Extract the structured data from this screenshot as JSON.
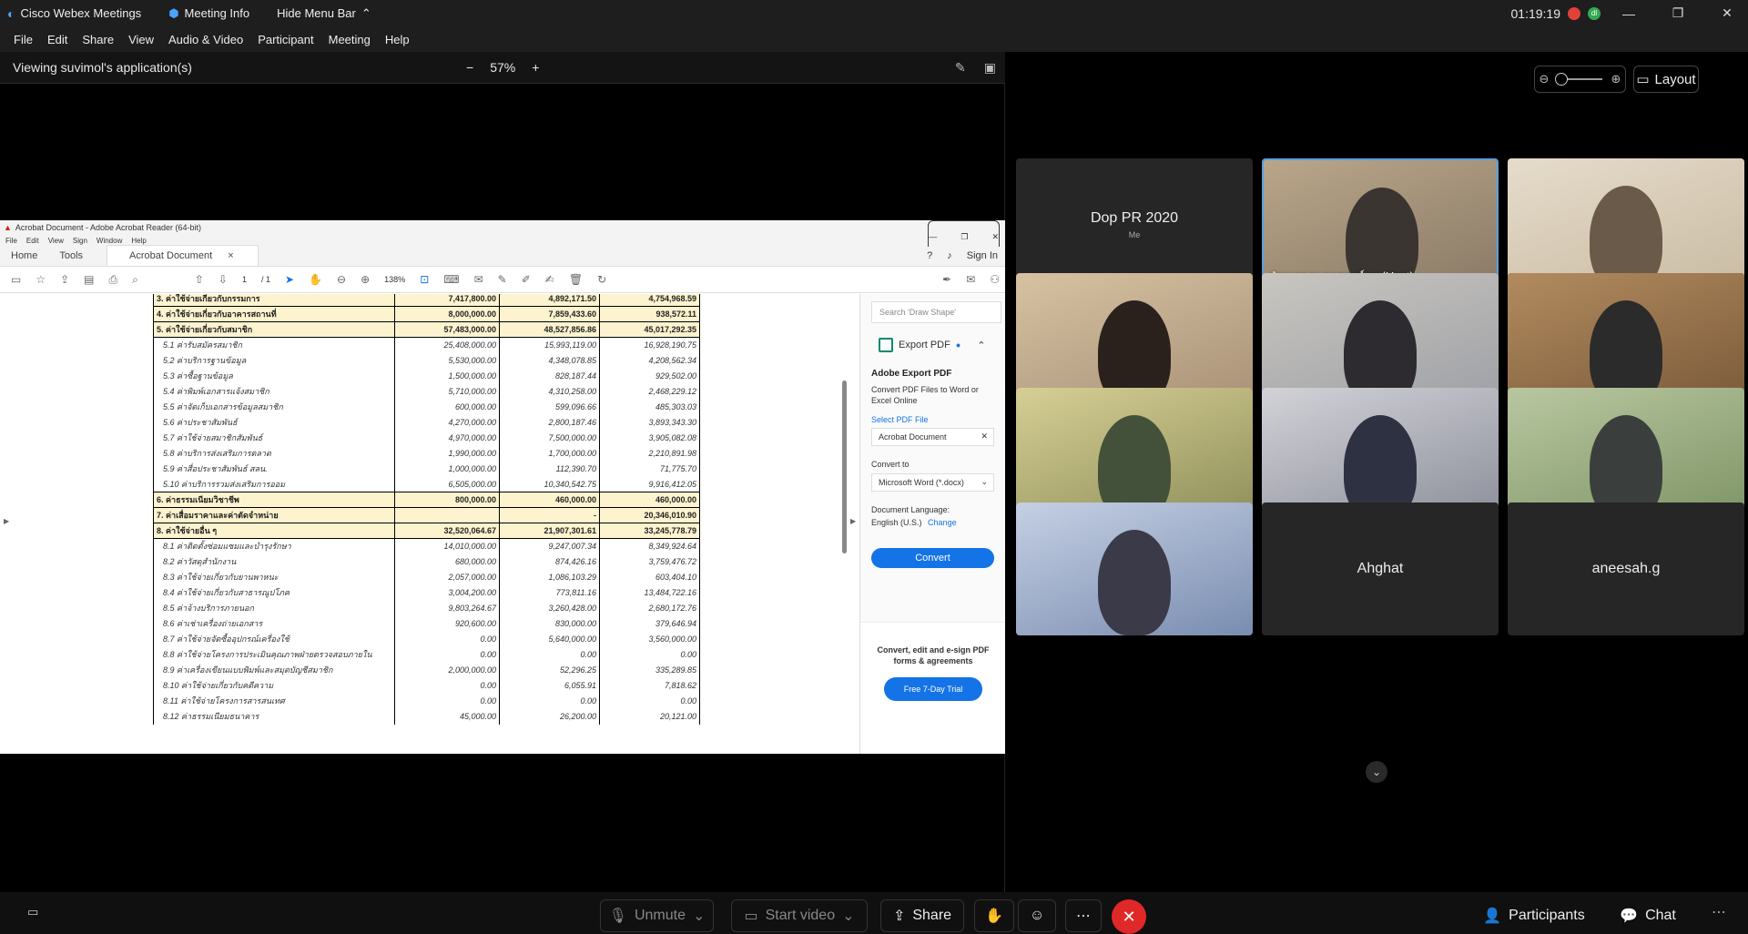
{
  "titlebar": {
    "app": "Cisco Webex Meetings",
    "meeting_info": "Meeting Info",
    "hide_menu": "Hide Menu Bar",
    "time": "01:19:19",
    "avatar_initial": "dl"
  },
  "menu": [
    "File",
    "Edit",
    "Share",
    "View",
    "Audio & Video",
    "Participant",
    "Meeting",
    "Help"
  ],
  "viewbar": {
    "title": "Viewing suvimol's application(s)",
    "zoom": "57%"
  },
  "acrobat": {
    "window_title": "Acrobat Document - Adobe Acrobat Reader (64-bit)",
    "menu": [
      "File",
      "Edit",
      "View",
      "Sign",
      "Window",
      "Help"
    ],
    "tabs": {
      "home": "Home",
      "tools": "Tools",
      "doc": "Acrobat Document"
    },
    "sign_in": "Sign In",
    "page": "1",
    "page_total": "/ 1",
    "zoom": "138%",
    "table": [
      {
        "bold": true,
        "label": "3. ค่าใช้จ่ายเกี่ยวกับกรรมการ",
        "a": "7,417,800.00",
        "b": "4,892,171.50",
        "c": "4,754,968.59"
      },
      {
        "bold": true,
        "label": "4. ค่าใช้จ่ายเกี่ยวกับอาคารสถานที่",
        "a": "8,000,000.00",
        "b": "7,859,433.60",
        "c": "938,572.11"
      },
      {
        "bold": true,
        "label": "5. ค่าใช้จ่ายเกี่ยวกับสมาชิก",
        "a": "57,483,000.00",
        "b": "48,527,856.86",
        "c": "45,017,292.35"
      },
      {
        "bold": false,
        "label": "5.1 ค่ารับสมัครสมาชิก",
        "a": "25,408,000.00",
        "b": "15,993,119.00",
        "c": "16,928,190.75"
      },
      {
        "bold": false,
        "label": "5.2 ค่าบริการฐานข้อมูล",
        "a": "5,530,000.00",
        "b": "4,348,078.85",
        "c": "4,208,562.34"
      },
      {
        "bold": false,
        "label": "5.3 ค่าซื้อฐานข้อมูล",
        "a": "1,500,000.00",
        "b": "828,187.44",
        "c": "929,502.00"
      },
      {
        "bold": false,
        "label": "5.4 ค่าพิมพ์เอกสารแจ้งสมาชิก",
        "a": "5,710,000.00",
        "b": "4,310,258.00",
        "c": "2,468,229.12"
      },
      {
        "bold": false,
        "label": "5.5 ค่าจัดเก็บเอกสารข้อมูลสมาชิก",
        "a": "600,000.00",
        "b": "599,096.66",
        "c": "485,303.03"
      },
      {
        "bold": false,
        "label": "5.6 ค่าประชาสัมพันธ์",
        "a": "4,270,000.00",
        "b": "2,800,187.46",
        "c": "3,893,343.30"
      },
      {
        "bold": false,
        "label": "5.7 ค่าใช้จ่ายสมาชิกสัมพันธ์",
        "a": "4,970,000.00",
        "b": "7,500,000.00",
        "c": "3,905,082.08"
      },
      {
        "bold": false,
        "label": "5.8 ค่าบริการส่งเสริมการตลาด",
        "a": "1,990,000.00",
        "b": "1,700,000.00",
        "c": "2,210,891.98"
      },
      {
        "bold": false,
        "label": "5.9 ค่าสื่อประชาสัมพันธ์ สลน.",
        "a": "1,000,000.00",
        "b": "112,390.70",
        "c": "71,775.70"
      },
      {
        "bold": false,
        "label": "5.10 ค่าบริการรวมส่งเสริมการออม",
        "a": "6,505,000.00",
        "b": "10,340,542.75",
        "c": "9,916,412.05"
      },
      {
        "bold": true,
        "label": "6. ค่าธรรมเนียมวิชาชีพ",
        "a": "800,000.00",
        "b": "460,000.00",
        "c": "460,000.00"
      },
      {
        "bold": true,
        "label": "7. ค่าเสื่อมราคาและค่าตัดจำหน่าย",
        "a": "",
        "b": "-",
        "c": "20,346,010.90"
      },
      {
        "bold": true,
        "label": "8. ค่าใช้จ่ายอื่น ๆ",
        "a": "32,520,064.67",
        "b": "21,907,301.61",
        "c": "33,245,778.79"
      },
      {
        "bold": false,
        "label": "8.1 ค่าติดตั้งซ่อมแซมและบำรุงรักษา",
        "a": "14,010,000.00",
        "b": "9,247,007.34",
        "c": "8,349,924.64"
      },
      {
        "bold": false,
        "label": "8.2 ค่าวัสดุสำนักงาน",
        "a": "680,000.00",
        "b": "874,426.16",
        "c": "3,759,476.72"
      },
      {
        "bold": false,
        "label": "8.3 ค่าใช้จ่ายเกี่ยวกับยานพาหนะ",
        "a": "2,057,000.00",
        "b": "1,086,103.29",
        "c": "603,404.10"
      },
      {
        "bold": false,
        "label": "8.4 ค่าใช้จ่ายเกี่ยวกับสาธารณูปโภค",
        "a": "3,004,200.00",
        "b": "773,811.16",
        "c": "13,484,722.16"
      },
      {
        "bold": false,
        "label": "8.5 ค่าจ้างบริการภายนอก",
        "a": "9,803,264.67",
        "b": "3,260,428.00",
        "c": "2,680,172.76"
      },
      {
        "bold": false,
        "label": "8.6 ค่าเช่าเครื่องถ่ายเอกสาร",
        "a": "920,600.00",
        "b": "830,000.00",
        "c": "379,646.94"
      },
      {
        "bold": false,
        "label": "8.7 ค่าใช้จ่ายจัดซื้ออุปกรณ์เครื่องใช้",
        "a": "0.00",
        "b": "5,640,000.00",
        "c": "3,560,000.00"
      },
      {
        "bold": false,
        "label": "8.8 ค่าใช้จ่ายโครงการประเมินคุณภาพฝ่ายตรวจสอบภายใน",
        "a": "0.00",
        "b": "0.00",
        "c": "0.00"
      },
      {
        "bold": false,
        "label": "8.9 ค่าเครื่องเขียนแบบพิมพ์และสมุดบัญชีสมาชิก",
        "a": "2,000,000.00",
        "b": "52,296.25",
        "c": "335,289.85"
      },
      {
        "bold": false,
        "label": "8.10 ค่าใช้จ่ายเกี่ยวกับคดีความ",
        "a": "0.00",
        "b": "6,055.91",
        "c": "7,818.62"
      },
      {
        "bold": false,
        "label": "8.11 ค่าใช้จ่ายโครงการสารสนเทศ",
        "a": "0.00",
        "b": "0.00",
        "c": "0.00"
      },
      {
        "bold": false,
        "label": "8.12 ค่าธรรมเนียมธนาคาร",
        "a": "45,000.00",
        "b": "26,200.00",
        "c": "20,121.00"
      }
    ],
    "pane": {
      "search_placeholder": "Search 'Draw Shape'",
      "export_pdf": "Export PDF",
      "heading": "Adobe Export PDF",
      "desc": "Convert PDF Files to Word or Excel Online",
      "select_file": "Select PDF File",
      "file_value": "Acrobat Document",
      "convert_to": "Convert to",
      "format_value": "Microsoft Word (*.docx)",
      "doc_language": "Document Language:",
      "language_value": "English (U.S.)",
      "change": "Change",
      "convert_button": "Convert",
      "promo_text": "Convert, edit and e-sign PDF forms & agreements",
      "trial_button": "Free 7-Day Trial"
    }
  },
  "layout": {
    "label": "Layout"
  },
  "participants": [
    {
      "name": "Dop PR 2020",
      "sub": "Me",
      "video": false
    },
    {
      "name": "ฝ่ายเลขานุการองค์กร (Host)",
      "sub": "",
      "video": true,
      "active": true
    },
    {
      "name": "",
      "sub": "",
      "video": true
    },
    {
      "name": "",
      "sub": "",
      "video": true
    },
    {
      "name": "",
      "sub": "",
      "video": true
    },
    {
      "name": "",
      "sub": "",
      "video": true
    },
    {
      "name": "",
      "sub": "",
      "video": true
    },
    {
      "name": "",
      "sub": "",
      "video": true
    },
    {
      "name": "",
      "sub": "",
      "video": true
    },
    {
      "name": "",
      "sub": "",
      "video": true
    },
    {
      "name": "Ahghat",
      "sub": "",
      "video": false
    },
    {
      "name": "aneesah.g",
      "sub": "",
      "video": false
    }
  ],
  "controls": {
    "unmute": "Unmute",
    "start_video": "Start video",
    "share": "Share",
    "participants": "Participants",
    "chat": "Chat"
  },
  "colors": {
    "accent": "#1473e6",
    "end": "#e02828",
    "highlight_row": "#fdf3cf"
  }
}
